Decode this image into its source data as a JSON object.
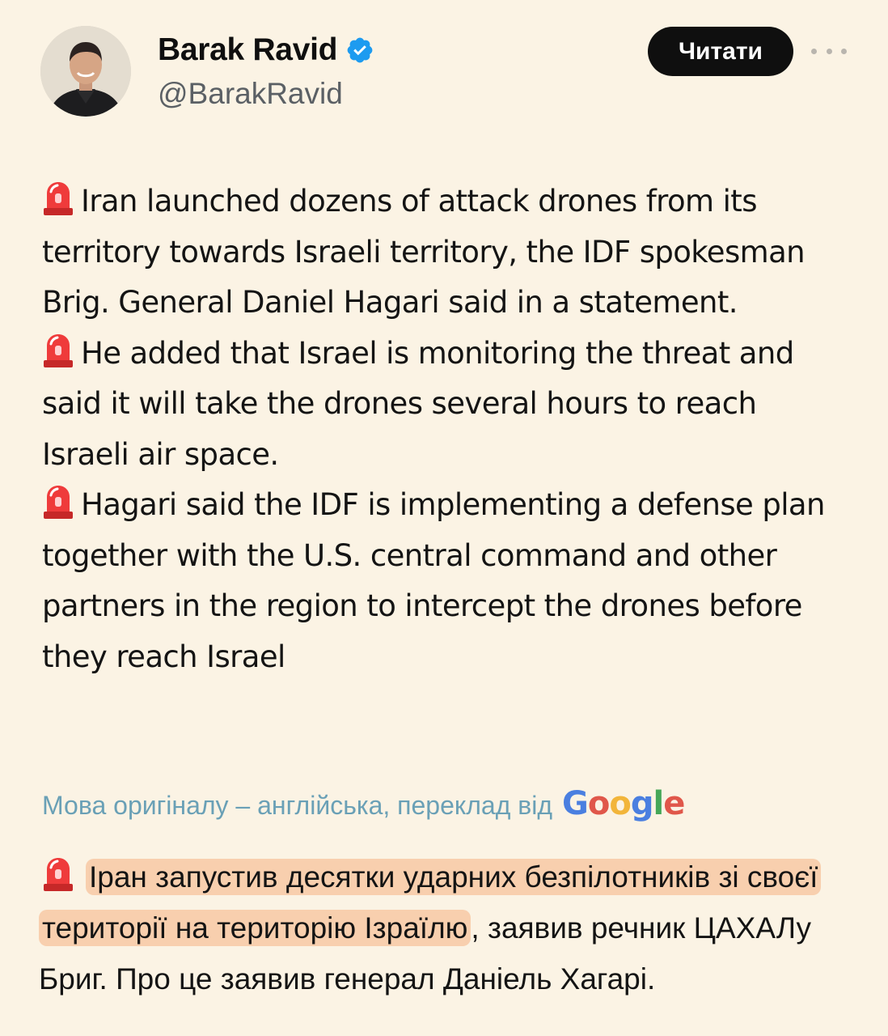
{
  "author": {
    "name": "Barak Ravid",
    "handle": "@BarakRavid",
    "verified": true
  },
  "follow_button": {
    "label": "Читати"
  },
  "tweet": {
    "paragraphs": [
      {
        "icon": "rotating-light-siren-icon",
        "text": "Iran launched dozens of attack drones from its territory towards Israeli territory, the IDF spokesman Brig. General Daniel Hagari said in a statement."
      },
      {
        "icon": "rotating-light-siren-icon",
        "text": "He added that Israel is monitoring the threat and said it will take the drones several hours to reach Israeli air space."
      },
      {
        "icon": "rotating-light-siren-icon",
        "text": "Hagari said the IDF is implementing a defense plan together with the U.S. central command and other partners in the region to intercept the drones before they reach Israel"
      }
    ]
  },
  "translation_note": {
    "text": "Мова оригіналу – англійська, переклад від",
    "provider": "Google"
  },
  "translation": {
    "highlighted": "Іран запустив десятки ударних безпілотників зі своєї території на територію Ізраїлю",
    "rest": ", заявив речник ЦАХАЛу Бриг. Про це заявив генерал Даніель Хагарі."
  },
  "colors": {
    "background": "#fbf3e4",
    "button_bg": "#0f0f0f",
    "verified_badge": "#1d9bf0",
    "translate_link": "#6aa0b6",
    "highlight": "#f8cfae"
  }
}
